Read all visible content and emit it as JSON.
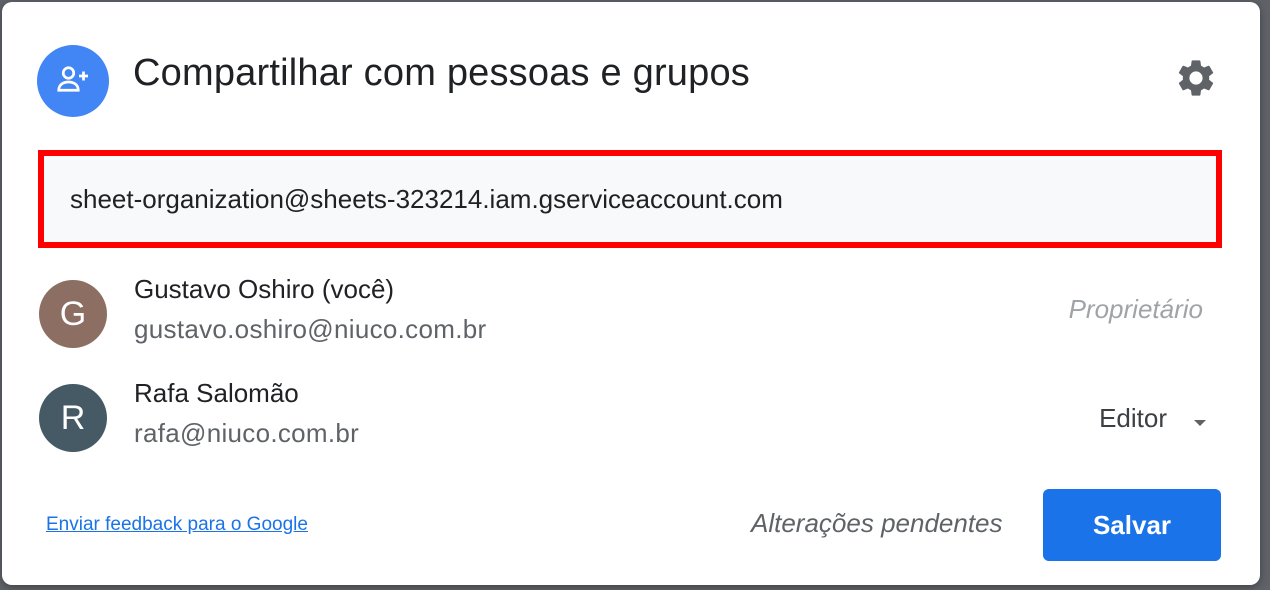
{
  "dialog": {
    "title": "Compartilhar com pessoas e grupos",
    "header_icon": "person-add-icon",
    "settings_icon": "gear-icon"
  },
  "share_input": {
    "value": "sheet-organization@sheets-323214.iam.gserviceaccount.com",
    "highlight_color": "#ff0000"
  },
  "people": [
    {
      "initial": "G",
      "name": "Gustavo Oshiro (você)",
      "email": "gustavo.oshiro@niuco.com.br",
      "role": "Proprietário",
      "avatar_color": "#8d6e63"
    },
    {
      "initial": "R",
      "name": "Rafa Salomão",
      "email": "rafa@niuco.com.br",
      "role": "Editor",
      "avatar_color": "#455a64"
    }
  ],
  "footer": {
    "feedback_link": "Enviar feedback para o Google",
    "pending_status": "Alterações pendentes",
    "save_label": "Salvar"
  },
  "colors": {
    "accent": "#1a73e8",
    "header_avatar": "#4285f4"
  }
}
